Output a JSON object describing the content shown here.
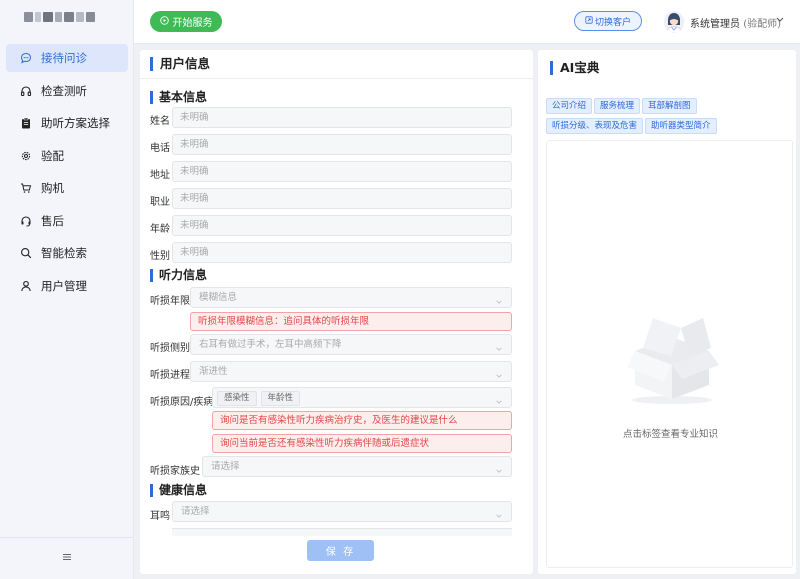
{
  "sidebar": {
    "items": [
      {
        "label": "接待问诊",
        "icon": "chat-bubble-icon",
        "active": true
      },
      {
        "label": "检查测听",
        "icon": "headphones-icon",
        "active": false
      },
      {
        "label": "助听方案选择",
        "icon": "clipboard-icon",
        "active": false
      },
      {
        "label": "验配",
        "icon": "gear-icon",
        "active": false
      },
      {
        "label": "购机",
        "icon": "cart-icon",
        "active": false
      },
      {
        "label": "售后",
        "icon": "headset-icon",
        "active": false
      },
      {
        "label": "智能检索",
        "icon": "search-icon",
        "active": false
      },
      {
        "label": "用户管理",
        "icon": "user-icon",
        "active": false
      }
    ],
    "collapse_icon": "menu-icon"
  },
  "header": {
    "start_button": "开始服务",
    "switch_button": "切换客户",
    "user_name": "系统管理员",
    "user_role": "(验配师)"
  },
  "left_panel": {
    "title": "用户信息",
    "basic": {
      "title": "基本信息",
      "fields": [
        {
          "label": "姓名",
          "placeholder": "未明确"
        },
        {
          "label": "电话",
          "placeholder": "未明确"
        },
        {
          "label": "地址",
          "placeholder": "未明确"
        },
        {
          "label": "职业",
          "placeholder": "未明确"
        },
        {
          "label": "年龄",
          "placeholder": "未明确"
        },
        {
          "label": "性别",
          "placeholder": "未明确"
        }
      ]
    },
    "hearing": {
      "title": "听力信息",
      "duration_label": "听损年限",
      "duration_value": "模糊信息",
      "duration_alert": "听损年限模糊信息：追问具体的听损年限",
      "side_label": "听损侧别",
      "side_value": "右耳有做过手术，左耳中高频下降",
      "progress_label": "听损进程",
      "progress_value": "渐进性",
      "cause_label": "听损原因/疾病",
      "cause_tags": [
        "感染性",
        "年龄性"
      ],
      "cause_alert_1": "询问是否有感染性听力疾病治疗史，及医生的建议是什么",
      "cause_alert_2": "询问当前是否还有感染性听力疾病伴随或后遗症状",
      "family_label": "听损家族史",
      "family_placeholder": "请选择"
    },
    "health": {
      "title": "健康信息",
      "tinnitus_label": "耳鸣",
      "tinnitus_placeholder": "请选择"
    },
    "save_button": "保 存"
  },
  "right_panel": {
    "title": "AI宝典",
    "tags": [
      "公司介绍",
      "服务梳理",
      "耳部解剖图",
      "听损分级、表现及危害",
      "助听器类型简介"
    ],
    "empty_hint": "点击标签查看专业知识"
  },
  "colors": {
    "accent": "#2d6bd9",
    "start_green": "#3fba55",
    "alert_red": "#e24646"
  }
}
